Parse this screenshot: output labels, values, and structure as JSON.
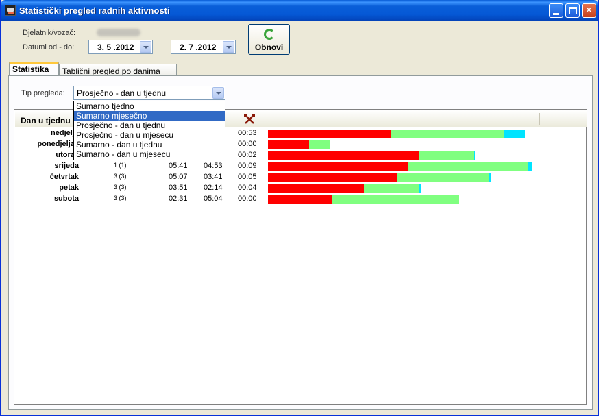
{
  "window": {
    "title": "Statistički pregled radnih aktivnosti"
  },
  "form": {
    "employee_label": "Djelatnik/vozač:",
    "dates_label": "Datumi od - do:",
    "date_from": "3. 5 .2012",
    "date_to": "2. 7 .2012",
    "refresh_label": "Obnovi"
  },
  "tabs": [
    {
      "label": "Statistika",
      "active": true
    },
    {
      "label": "Tablični pregled po danima",
      "active": false
    }
  ],
  "view": {
    "type_label": "Tip pregleda:",
    "selected": "Prosječno - dan u tjednu",
    "options": [
      "Sumarno tjedno",
      "Sumarno mjesečno",
      "Prosječno - dan u tjednu",
      "Prosječno - dan u mjesecu",
      "Sumarno - dan u tjednu",
      "Sumarno - dan u mjesecu"
    ],
    "highlighted_index": 1
  },
  "grid": {
    "first_column_header": "Dan u tjednu",
    "rows": [
      {
        "day": "nedjelja",
        "count": "",
        "t1": "",
        "t2": "",
        "t3": "00:53",
        "bar": [
          36,
          33,
          6
        ]
      },
      {
        "day": "ponedjeljak",
        "count": "",
        "t1": "",
        "t2": "",
        "t3": "00:00",
        "bar": [
          12,
          6,
          0
        ]
      },
      {
        "day": "utorak",
        "count": "",
        "t1": "",
        "t2": "",
        "t3": "00:02",
        "bar": [
          44,
          16,
          0.3
        ]
      },
      {
        "day": "srijeda",
        "count": "1 (1)",
        "t1": "05:41",
        "t2": "04:53",
        "t3": "00:09",
        "bar": [
          41,
          35,
          1
        ]
      },
      {
        "day": "četvrtak",
        "count": "3 (3)",
        "t1": "05:07",
        "t2": "03:41",
        "t3": "00:05",
        "bar": [
          37.5,
          27,
          0.6
        ]
      },
      {
        "day": "petak",
        "count": "3 (3)",
        "t1": "03:51",
        "t2": "02:14",
        "t3": "00:04",
        "bar": [
          28,
          16,
          0.5
        ]
      },
      {
        "day": "subota",
        "count": "3 (3)",
        "t1": "02:31",
        "t2": "05:04",
        "t3": "00:00",
        "bar": [
          18.5,
          37,
          0
        ]
      }
    ]
  },
  "colors": {
    "bar_red": "#ff0000",
    "bar_green": "#80ff80",
    "bar_cyan": "#00e4ff"
  }
}
